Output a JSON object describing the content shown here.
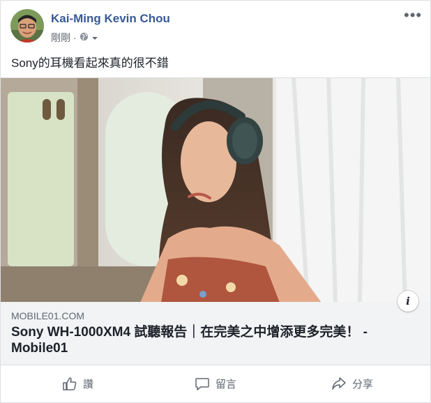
{
  "post": {
    "author": "Kai-Ming Kevin Chou",
    "timestamp": "剛剛",
    "separator": "·",
    "audience_icon": "globe-icon",
    "status_text": "Sony的耳機看起來真的很不錯"
  },
  "link_preview": {
    "domain": "MOBILE01.COM",
    "title": "Sony WH-1000XM4 試聽報告｜在完美之中增添更多完美！ - Mobile01",
    "info_label": "i"
  },
  "actions": {
    "like_label": "讚",
    "comment_label": "留言",
    "share_label": "分享"
  },
  "colors": {
    "author": "#365899",
    "text": "#1d2129",
    "secondary": "#606770",
    "card_meta_bg": "#f2f3f5"
  }
}
